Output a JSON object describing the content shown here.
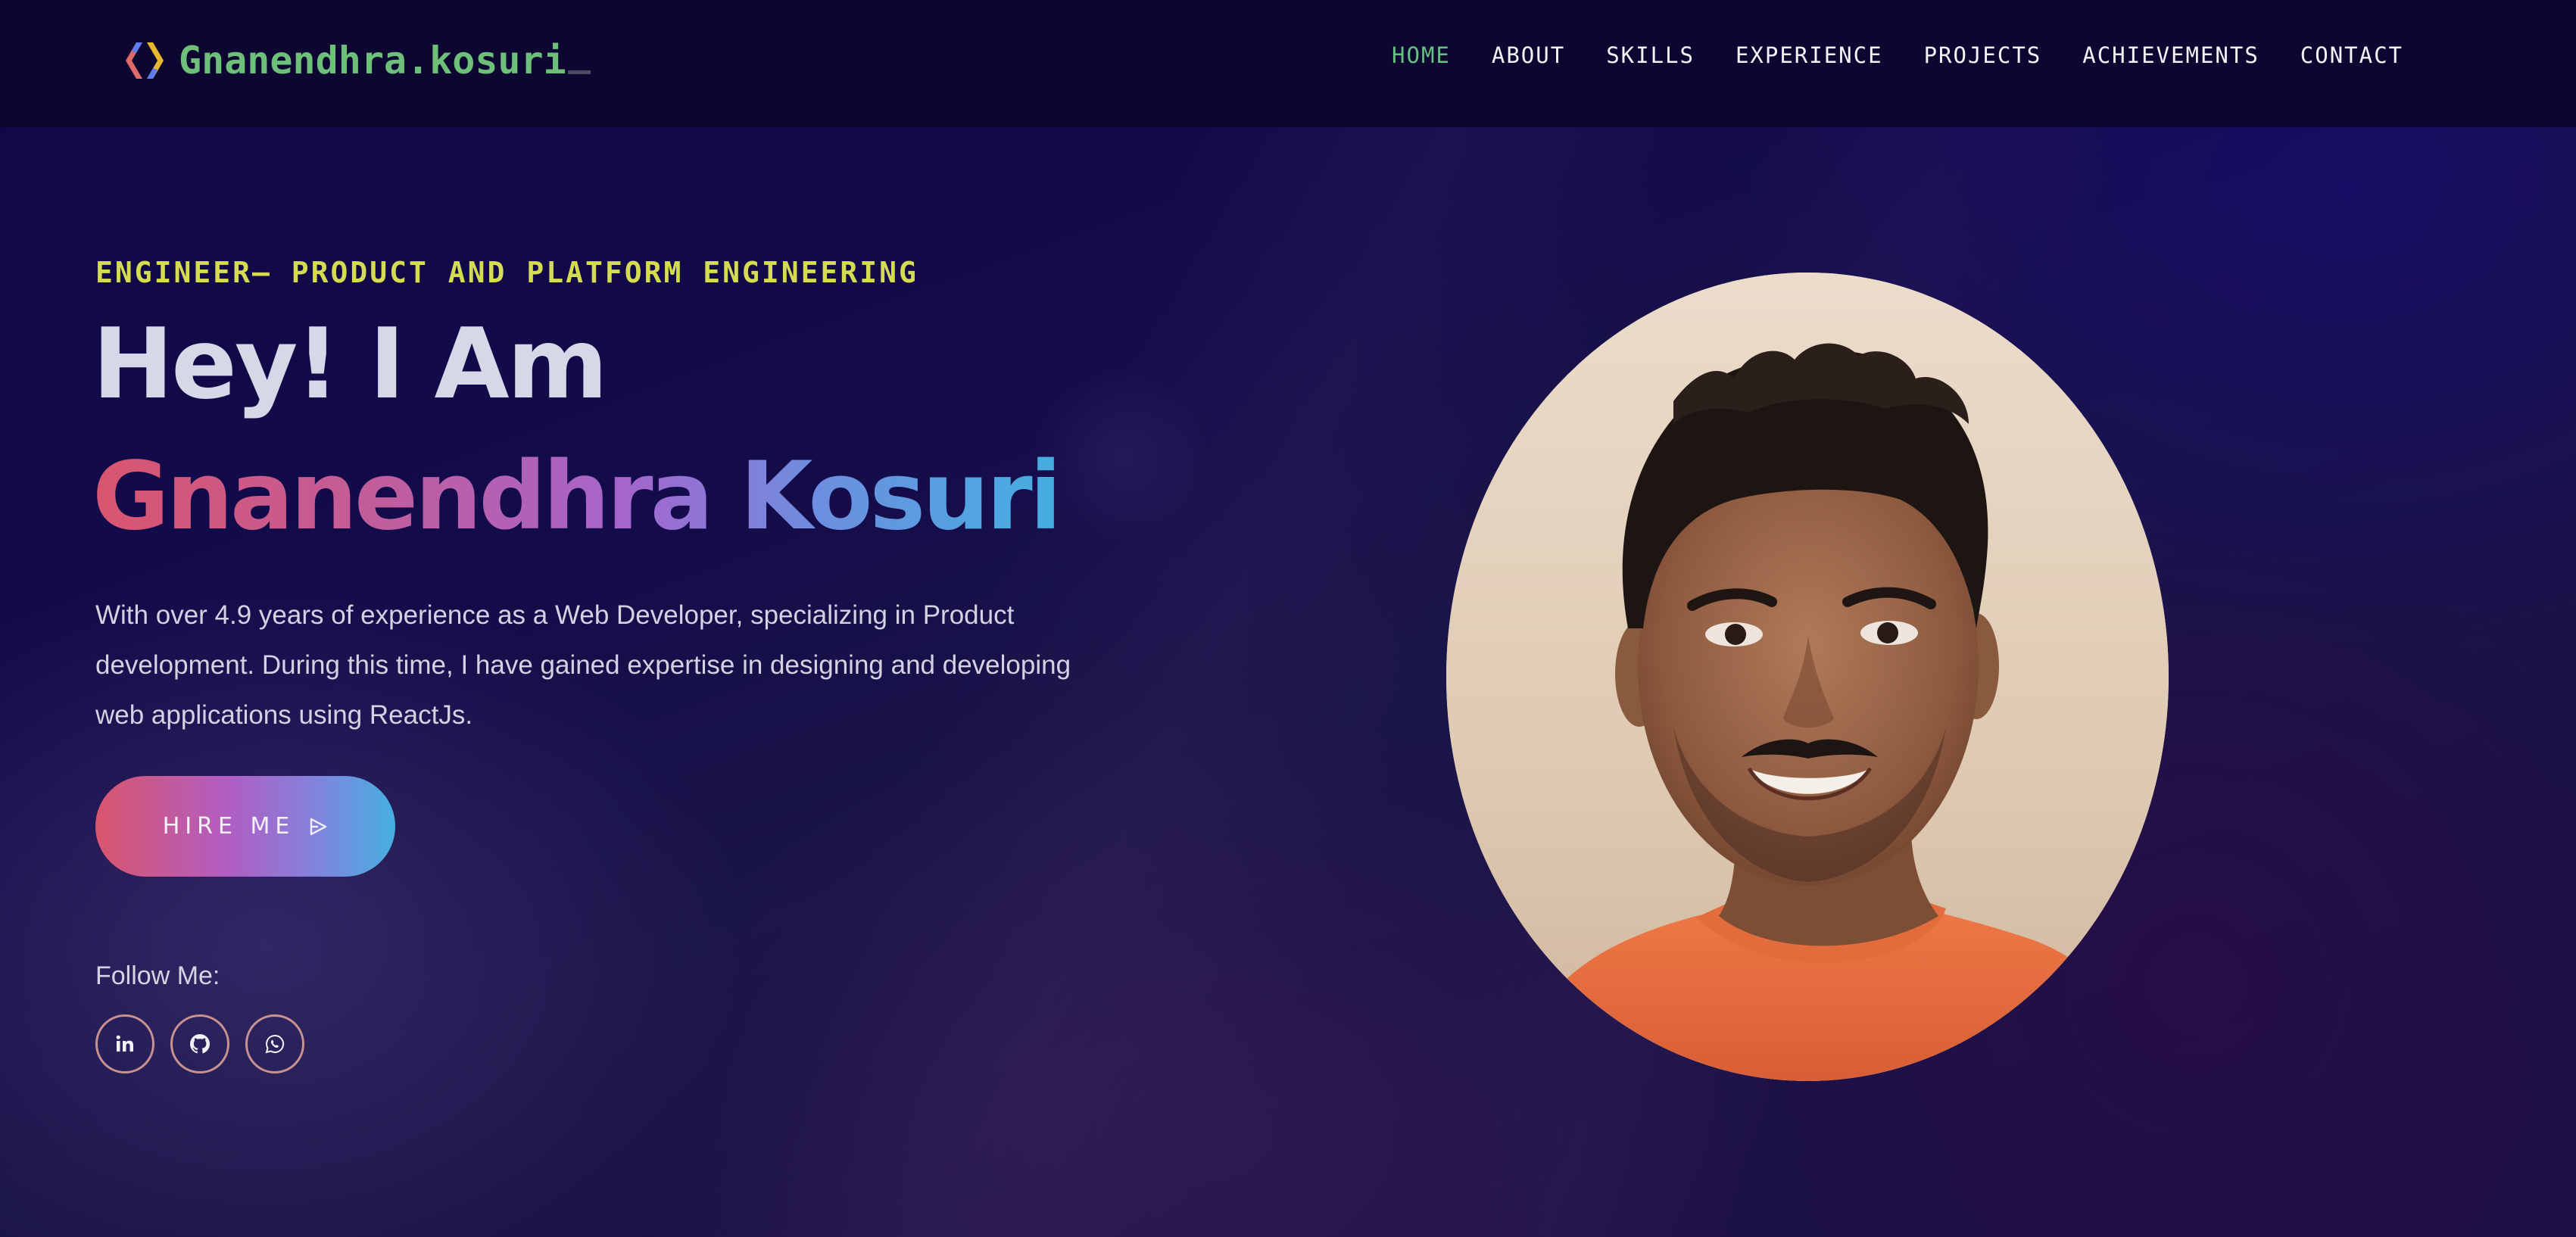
{
  "brand": {
    "name": "Gnanendhra.kosuri",
    "logo_icon": "code-brackets-icon",
    "colors": {
      "green": "#6dbf7a",
      "blue": "#5d7cf0",
      "yellow": "#e8b930"
    }
  },
  "nav": {
    "items": [
      {
        "label": "HOME",
        "active": true
      },
      {
        "label": "ABOUT",
        "active": false
      },
      {
        "label": "SKILLS",
        "active": false
      },
      {
        "label": "EXPERIENCE",
        "active": false
      },
      {
        "label": "PROJECTS",
        "active": false
      },
      {
        "label": "ACHIEVEMENTS",
        "active": false
      },
      {
        "label": "CONTACT",
        "active": false
      }
    ],
    "active_color": "#66c182"
  },
  "hero": {
    "tagline": "ENGINEER– PRODUCT AND PLATFORM ENGINEERING",
    "greeting": "Hey! I Am",
    "name": "Gnanendhra Kosuri",
    "bio": "With over 4.9 years of experience as a Web Developer, specializing in Product development. During this time, I have gained expertise in designing and developing web applications using ReactJs.",
    "cta_label": "HIRE ME",
    "cta_icon": "send-icon",
    "follow_label": "Follow Me:",
    "socials": [
      {
        "name": "linkedin-icon"
      },
      {
        "name": "github-icon"
      },
      {
        "name": "whatsapp-icon"
      }
    ],
    "accent_gradient": [
      "#d9556e",
      "#a565cc",
      "#45aee0"
    ],
    "tagline_color": "#d6dc52"
  },
  "portrait": {
    "subject": "profile-photo",
    "shirt_color": "#e8683e",
    "wall_color": "#e6d3bf"
  }
}
